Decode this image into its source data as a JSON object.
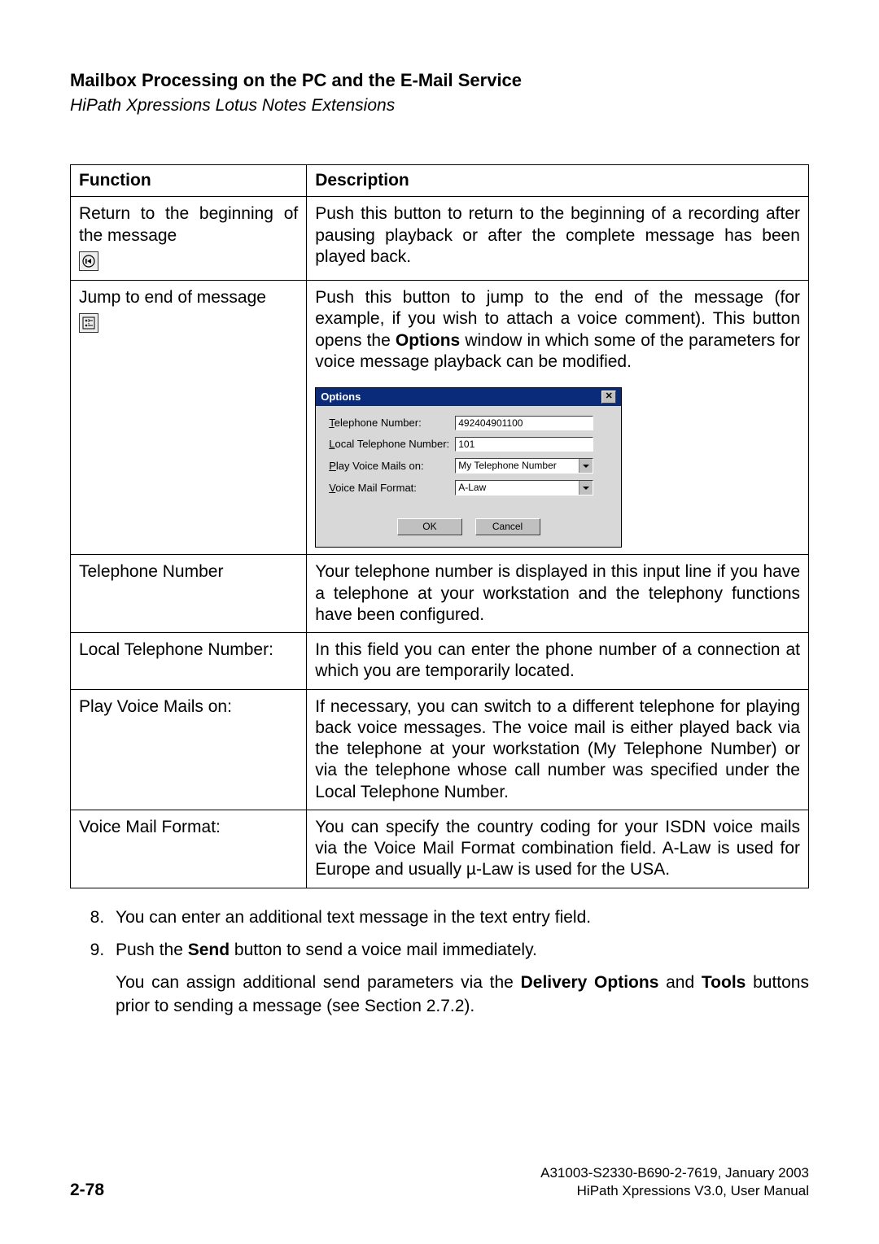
{
  "header": {
    "title": "Mailbox Processing on the PC and the E-Mail Service",
    "subtitle": "HiPath Xpressions Lotus Notes Extensions"
  },
  "table": {
    "cols": {
      "func": "Function",
      "desc": "Description"
    },
    "rows": [
      {
        "id": "return-begin",
        "func": "Return to the beginning of the message",
        "icon_glyph": "",
        "icon": "return-to-start-icon",
        "desc": "Push this button to return to the beginning of a recording after pausing playback or after the complete message has been played back."
      },
      {
        "id": "jump-end",
        "func": "Jump to end of message",
        "icon_glyph": "",
        "icon": "jump-to-end-icon",
        "desc_pre": "Push this button to jump to the end of the message (for example, if you wish to attach a voice comment).\nThis button opens the ",
        "desc_bold": "Options",
        "desc_post": " window in which some of the parameters for voice message playback can be modified.",
        "dialog": {
          "title": "Options",
          "rows": [
            {
              "label_prefix_u": "T",
              "label_rest": "elephone Number:",
              "value": "492404901100",
              "type": "input",
              "name": "telephone-number-field"
            },
            {
              "label_prefix_u": "L",
              "label_rest": "ocal Telephone Number:",
              "value": "101",
              "type": "input",
              "name": "local-telephone-number-field"
            },
            {
              "label_prefix_u": "P",
              "label_rest": "lay Voice Mails on:",
              "value": "My Telephone Number",
              "type": "select",
              "name": "play-voice-mails-select"
            },
            {
              "label_prefix_u": "V",
              "label_rest": "oice Mail Format:",
              "value": "A-Law",
              "type": "select",
              "name": "voice-mail-format-select"
            }
          ],
          "ok": "OK",
          "cancel": "Cancel"
        }
      },
      {
        "id": "telephone-number",
        "func": "Telephone Number",
        "desc": "Your telephone number is displayed in this input line if you have a telephone at your workstation and the telephony functions have been configured."
      },
      {
        "id": "local-telephone-number",
        "func": "Local Telephone Number:",
        "desc": "In this field you can enter the phone number of a connection at which you are temporarily located."
      },
      {
        "id": "play-voice-mails-on",
        "func": "Play Voice Mails on:",
        "desc": "If necessary, you can switch to a different telephone for playing back voice messages. The voice mail is either played back via the telephone at your workstation (My Telephone Number) or via the telephone whose call number was specified under the Local Telephone Number."
      },
      {
        "id": "voice-mail-format",
        "func": "Voice Mail Format:",
        "desc": "You can specify the country coding for your ISDN voice mails via the Voice Mail Format combination field. A-Law is used for Europe and usually µ-Law is used for the USA."
      }
    ]
  },
  "after": {
    "item8": "You can enter an additional text message in the text entry field.",
    "item9_pre": "Push the ",
    "item9_bold": "Send",
    "item9_post": " button to send a voice mail immediately.",
    "para_pre": "You can assign additional send parameters via the ",
    "para_b1": "Delivery Options",
    "para_mid": " and ",
    "para_b2": "Tools",
    "para_post": " buttons prior to sending a message (see Section 2.7.2)."
  },
  "footer": {
    "page": "2-78",
    "doc_id": "A31003-S2330-B690-2-7619, January 2003",
    "product": "HiPath Xpressions V3.0, User Manual"
  }
}
